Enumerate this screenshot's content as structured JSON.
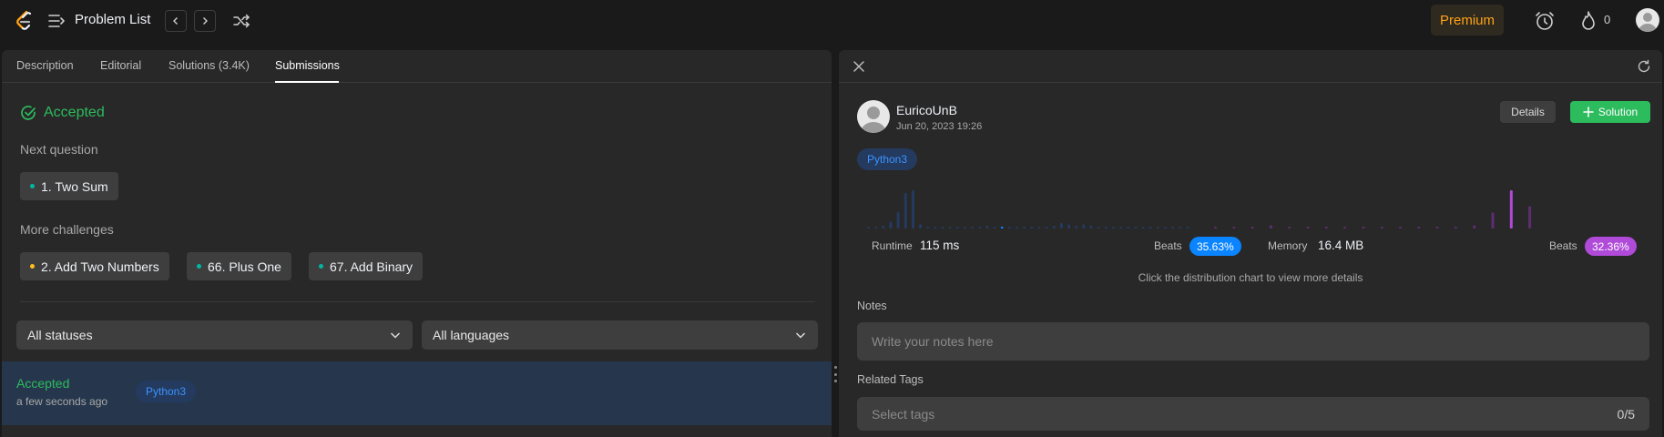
{
  "header": {
    "problem_list_label": "Problem List",
    "premium_label": "Premium",
    "streak_count": "0",
    "colors": {
      "premium_text": "#ffa116",
      "accent_green": "#2cbb5d"
    }
  },
  "left": {
    "tabs": [
      {
        "label": "Description"
      },
      {
        "label": "Editorial"
      },
      {
        "label": "Solutions (3.4K)"
      },
      {
        "label": "Submissions"
      }
    ],
    "status_title": "Accepted",
    "next_question_label": "Next question",
    "next_question": {
      "label": "1. Two Sum",
      "difficulty_color": "#00b8a3"
    },
    "more_challenges_label": "More challenges",
    "challenges": [
      {
        "label": "2. Add Two Numbers",
        "difficulty_color": "#ffc01e"
      },
      {
        "label": "66. Plus One",
        "difficulty_color": "#00b8a3"
      },
      {
        "label": "67. Add Binary",
        "difficulty_color": "#00b8a3"
      }
    ],
    "filters": {
      "status_selected": "All statuses",
      "language_selected": "All languages"
    },
    "submission": {
      "status": "Accepted",
      "time": "a few seconds ago",
      "language": "Python3"
    }
  },
  "right": {
    "author": "EuricoUnB",
    "date": "Jun 20, 2023 19:26",
    "details_label": "Details",
    "solution_label": "Solution",
    "language": "Python3",
    "runtime_label": "Runtime",
    "runtime_value": "115 ms",
    "runtime_beats_label": "Beats",
    "runtime_beats": "35.63%",
    "memory_label": "Memory",
    "memory_value": "16.4 MB",
    "memory_beats_label": "Beats",
    "memory_beats": "32.36%",
    "hint": "Click the distribution chart to view more details",
    "notes_label": "Notes",
    "notes_placeholder": "Write your notes here",
    "tags_label": "Related Tags",
    "tags_placeholder": "Select tags",
    "tags_count": "0/5",
    "colors": {
      "runtime_badge": "#0a84ff",
      "memory_badge": "#b04ad9",
      "runtime_bars": "#243a5e",
      "memory_bars": "#5b2e72"
    }
  },
  "chart_data": [
    {
      "type": "bar",
      "title": "",
      "series": [
        {
          "values": [
            1,
            1,
            2,
            5,
            12,
            26,
            28,
            3,
            1,
            1,
            1,
            1,
            1,
            1,
            1,
            1,
            2,
            1,
            1,
            1,
            1,
            1,
            1,
            1,
            1,
            2,
            4,
            3,
            2,
            3,
            2,
            1,
            1,
            1,
            1,
            1,
            1,
            1,
            1,
            1,
            1,
            1,
            1,
            1
          ]
        }
      ],
      "highlighted_index": 18
    },
    {
      "type": "bar",
      "title": "",
      "series": [
        {
          "values": [
            1,
            1,
            1,
            2,
            1,
            1,
            1,
            1,
            1,
            1,
            1,
            1,
            1,
            1,
            2,
            10,
            24,
            14
          ]
        }
      ],
      "highlighted_index": 16
    }
  ]
}
